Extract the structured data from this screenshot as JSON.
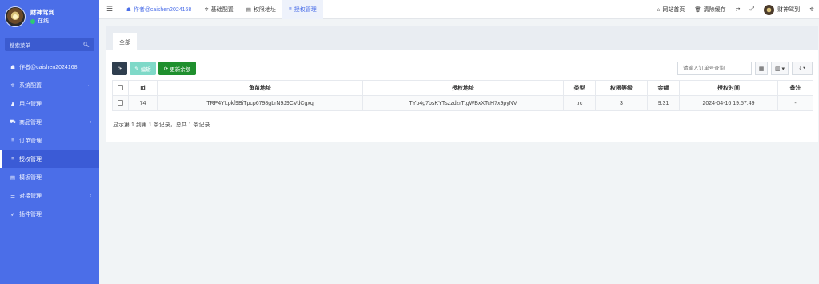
{
  "user": {
    "name": "财神驾到",
    "status": "在线"
  },
  "sidebar": {
    "search_label": "搜索菜单",
    "items": [
      {
        "name": "author",
        "icon": "dashboard-icon",
        "glyph": "☗",
        "label": "作者@caishen2024168",
        "has_chevron": false,
        "active": false
      },
      {
        "name": "system-config",
        "icon": "gear-icon",
        "glyph": "✲",
        "label": "系统配置",
        "has_chevron": true,
        "chevron": "⌄",
        "active": false
      },
      {
        "name": "user-manage",
        "icon": "user-icon",
        "glyph": "♟",
        "label": "用户管理",
        "has_chevron": false,
        "active": false
      },
      {
        "name": "product-manage",
        "icon": "cart-icon",
        "glyph": "⛟",
        "label": "商品管理",
        "has_chevron": true,
        "chevron": "‹",
        "active": false
      },
      {
        "name": "order-manage",
        "icon": "list-icon",
        "glyph": "≡",
        "label": "订单管理",
        "has_chevron": false,
        "active": false
      },
      {
        "name": "auth-manage",
        "icon": "list-icon",
        "glyph": "≡",
        "label": "授权管理",
        "has_chevron": false,
        "active": true
      },
      {
        "name": "template-manage",
        "icon": "template-icon",
        "glyph": "▤",
        "label": "模板管理",
        "has_chevron": false,
        "active": false
      },
      {
        "name": "dock-manage",
        "icon": "sliders-icon",
        "glyph": "☰",
        "label": "对接管理",
        "has_chevron": true,
        "chevron": "‹",
        "active": false
      },
      {
        "name": "plugin-manage",
        "icon": "rocket-icon",
        "glyph": "➶",
        "label": "插件管理",
        "has_chevron": false,
        "active": false
      }
    ]
  },
  "topnav": {
    "tabs": [
      {
        "icon": "dashboard-icon",
        "glyph": "☗",
        "label": "作者@caishen2024168"
      },
      {
        "icon": "gear-icon",
        "glyph": "✲",
        "label": "基础配置"
      },
      {
        "icon": "list-icon",
        "glyph": "▤",
        "label": "权限地址"
      },
      {
        "icon": "list-icon",
        "glyph": "≡",
        "label": "授权管理"
      }
    ],
    "right": {
      "home_label": "网站首页",
      "clear_cache_label": "清除缓存",
      "user_name": "财神驾到"
    }
  },
  "content": {
    "panel_tab": "全部",
    "buttons": {
      "edit": "编辑",
      "update_balance": "更新余额"
    },
    "search_placeholder": "请输入订单号查询",
    "table": {
      "headers": [
        "Id",
        "鱼苗地址",
        "授权地址",
        "类型",
        "权限等级",
        "余额",
        "授权时间",
        "备注"
      ],
      "rows": [
        [
          "74",
          "TRP4YLpkf9BiTpcp6798gLrN9J9CVdCgxq",
          "TYb4g7bsKYTszzdzrTtgWBxXTcH7x9pyNV",
          "trc",
          "3",
          "9.31",
          "2024-04-16 19:57:49",
          "-"
        ]
      ]
    },
    "summary": "显示第 1 到第 1 条记录，总共 1 条记录"
  },
  "colors": {
    "sidebar": "#4b6ee8",
    "update_button": "#1f8f2e",
    "edit_button": "#7fd9c8",
    "refresh_button": "#2f3e4e"
  }
}
